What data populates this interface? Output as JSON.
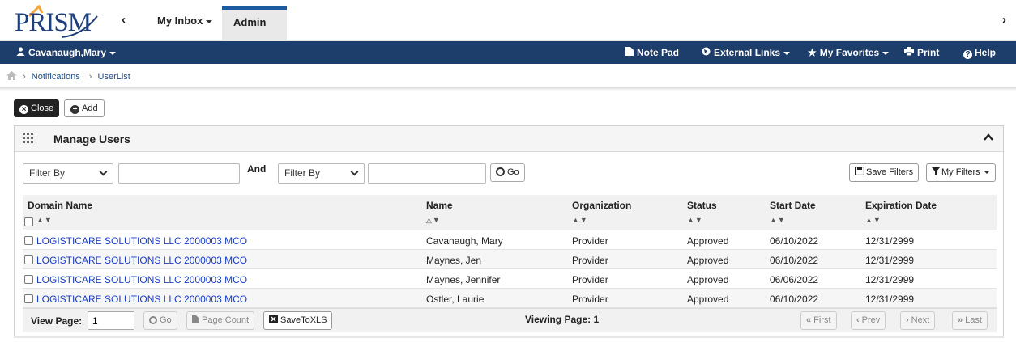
{
  "app": {
    "logo_text": "PRISM"
  },
  "topnav": {
    "back_glyph": "‹",
    "inbox_label": "My Inbox",
    "admin_label": "Admin",
    "forward_glyph": "›"
  },
  "userbar": {
    "user_name": "Cavanaugh,Mary",
    "note_pad": "Note Pad",
    "external_links": "External Links",
    "my_favorites": "My Favorites",
    "print": "Print",
    "help": "Help"
  },
  "breadcrumb": {
    "items": [
      "Notifications",
      "UserList"
    ]
  },
  "actions": {
    "close_label": "Close",
    "add_label": "Add"
  },
  "panel": {
    "title": "Manage Users",
    "filter1_value": "Filter By",
    "filter1_text": "",
    "and_label": "And",
    "filter2_value": "Filter By",
    "filter2_text": "",
    "go_label": "Go",
    "save_filters_label": "Save Filters",
    "my_filters_label": "My Filters"
  },
  "table": {
    "columns": [
      "Domain Name",
      "Name",
      "Organization",
      "Status",
      "Start Date",
      "Expiration Date"
    ],
    "sort_markers": [
      "▲▼",
      "△▼",
      "▲▼",
      "▲▼",
      "▲▼",
      "▲▼"
    ],
    "rows": [
      {
        "domain": "LOGISTICARE SOLUTIONS LLC 2000003 MCO",
        "name": "Cavanaugh, Mary",
        "org": "Provider",
        "status": "Approved",
        "start": "06/10/2022",
        "expiration": "12/31/2999"
      },
      {
        "domain": "LOGISTICARE SOLUTIONS LLC 2000003 MCO",
        "name": "Maynes, Jen",
        "org": "Provider",
        "status": "Approved",
        "start": "06/10/2022",
        "expiration": "12/31/2999"
      },
      {
        "domain": "LOGISTICARE SOLUTIONS LLC 2000003 MCO",
        "name": "Maynes, Jennifer",
        "org": "Provider",
        "status": "Approved",
        "start": "06/06/2022",
        "expiration": "12/31/2999"
      },
      {
        "domain": "LOGISTICARE SOLUTIONS LLC 2000003 MCO",
        "name": "Ostler, Laurie",
        "org": "Provider",
        "status": "Approved",
        "start": "06/10/2022",
        "expiration": "12/31/2999"
      }
    ]
  },
  "footer": {
    "view_page_label": "View Page:",
    "view_page_value": "1",
    "go_label": "Go",
    "page_count_label": "Page Count",
    "save_xls_label": "SaveToXLS",
    "viewing_label": "Viewing Page: 1",
    "first_label": "First",
    "prev_label": "Prev",
    "next_label": "Next",
    "last_label": "Last"
  },
  "colors": {
    "brand_blue": "#1d3d6b",
    "link_blue": "#1a3fc2",
    "accent_tab": "#1d5ba0"
  }
}
